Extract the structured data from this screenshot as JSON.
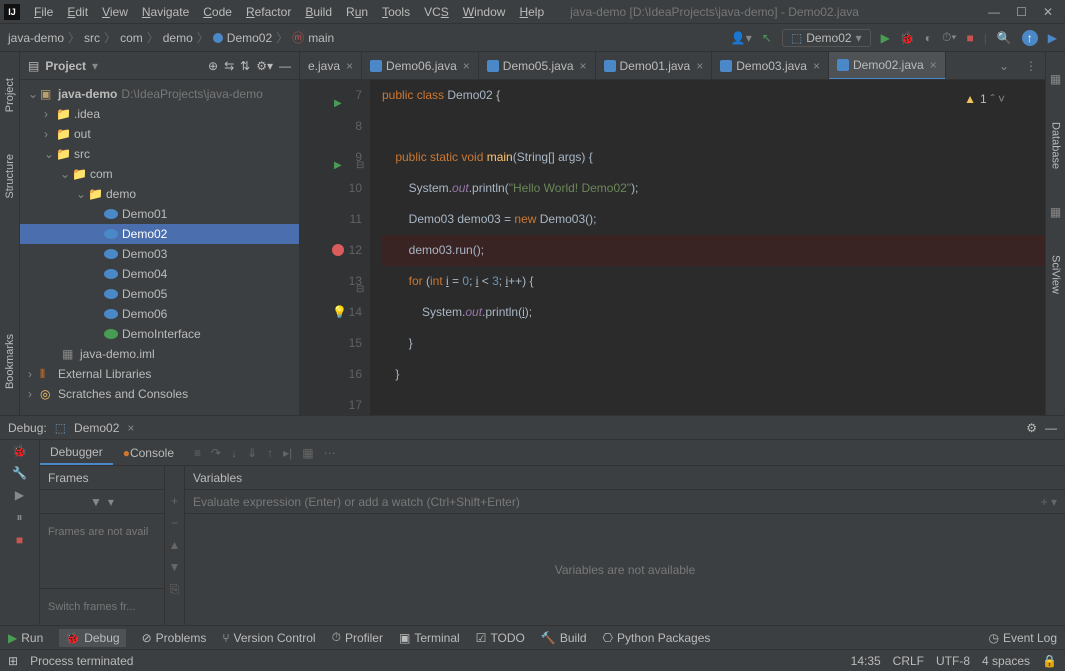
{
  "window": {
    "title": "java-demo [D:\\IdeaProjects\\java-demo] - Demo02.java"
  },
  "menu": [
    "File",
    "Edit",
    "View",
    "Navigate",
    "Code",
    "Refactor",
    "Build",
    "Run",
    "Tools",
    "VCS",
    "Window",
    "Help"
  ],
  "breadcrumb": [
    "java-demo",
    "src",
    "com",
    "demo",
    "Demo02",
    "main"
  ],
  "runconfig": "Demo02",
  "vleft": [
    "Project",
    "Structure",
    "Bookmarks"
  ],
  "vright": [
    "Database",
    "SciView"
  ],
  "project_panel": {
    "title": "Project",
    "root": {
      "name": "java-demo",
      "path": "D:\\IdeaProjects\\java-demo"
    },
    "idea": ".idea",
    "out": "out",
    "src": "src",
    "com": "com",
    "demo": "demo",
    "files": [
      "Demo01",
      "Demo02",
      "Demo03",
      "Demo04",
      "Demo05",
      "Demo06",
      "DemoInterface"
    ],
    "iml": "java-demo.iml",
    "ext": "External Libraries",
    "scratch": "Scratches and Consoles"
  },
  "tabs": [
    "e.java",
    "Demo06.java",
    "Demo05.java",
    "Demo01.java",
    "Demo03.java",
    "Demo02.java"
  ],
  "warn_count": "1",
  "code": {
    "l7": "public class Demo02 {",
    "l8": "",
    "l9a": "    public static void ",
    "l9b": "main",
    "l9c": "(String[] args) {",
    "l10a": "        System.",
    "l10b": "out",
    "l10c": ".println(",
    "l10d": "\"Hello World! Demo02\"",
    "l10e": ");",
    "l11a": "        Demo03 demo03 = ",
    "l11b": "new ",
    "l11c": "Demo03();",
    "l12": "        demo03.run();",
    "l13a": "        for ",
    "l13b": "(int ",
    "l13c": "i",
    "l13d": " = ",
    "l13e": "0",
    "l13f": "; ",
    "l13g": "i",
    "l13h": " < ",
    "l13i": "3",
    "l13j": "; ",
    "l13k": "i",
    "l13l": "++) {",
    "l14a": "            System.",
    "l14b": "out",
    "l14c": ".println(",
    "l14d": "i",
    "l14e": ");",
    "l15": "        }",
    "l16": "    }",
    "l17": ""
  },
  "lines": [
    "7",
    "8",
    "9",
    "10",
    "11",
    "12",
    "13",
    "14",
    "15",
    "16",
    "17"
  ],
  "debug": {
    "label": "Debug:",
    "config": "Demo02",
    "tabs": [
      "Debugger",
      "Console"
    ],
    "frames": "Frames",
    "variables": "Variables",
    "frames_msg": "Frames are not avail",
    "switch_msg": "Switch frames fr...",
    "eval_placeholder": "Evaluate expression (Enter) or add a watch (Ctrl+Shift+Enter)",
    "vars_msg": "Variables are not available"
  },
  "bottom": [
    "Run",
    "Debug",
    "Problems",
    "Version Control",
    "Profiler",
    "Terminal",
    "TODO",
    "Build",
    "Python Packages",
    "Event Log"
  ],
  "status": {
    "msg": "Process terminated",
    "time": "14:35",
    "eol": "CRLF",
    "enc": "UTF-8",
    "indent": "4 spaces"
  }
}
